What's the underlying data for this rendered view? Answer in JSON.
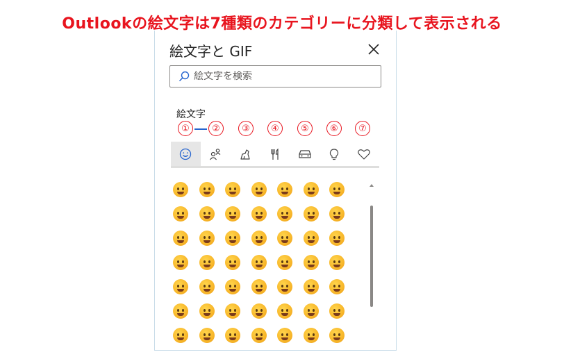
{
  "headline": "Outlookの絵文字は7種類のカテゴリーに分類して表示される",
  "panel": {
    "title": "絵文字と GIF",
    "search_placeholder": "絵文字を検索",
    "section_label": "絵文字"
  },
  "annotations": [
    "①",
    "②",
    "③",
    "④",
    "⑤",
    "⑥",
    "⑦"
  ],
  "tabs": [
    {
      "icon": "smiley-icon",
      "active": true
    },
    {
      "icon": "people-icon",
      "active": false
    },
    {
      "icon": "animal-icon",
      "active": false
    },
    {
      "icon": "food-icon",
      "active": false
    },
    {
      "icon": "car-icon",
      "active": false
    },
    {
      "icon": "lightbulb-icon",
      "active": false
    },
    {
      "icon": "heart-icon",
      "active": false
    }
  ],
  "emoji_grid": {
    "rows": 7,
    "cols": 7
  },
  "colors": {
    "annotation_red": "#e8141e",
    "accent_blue": "#2564cf"
  }
}
